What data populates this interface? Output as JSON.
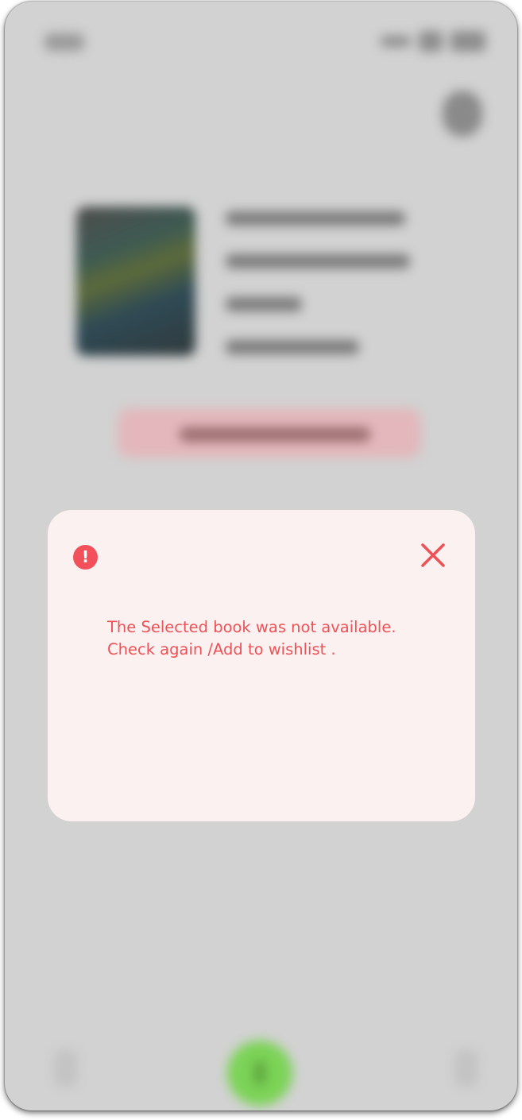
{
  "alert": {
    "icon": "exclamation-circle-icon",
    "icon_glyph": "!",
    "close_icon": "close-icon",
    "message_lines": [
      "The Selected book was not available.",
      "Check again /Add to wishlist ."
    ]
  },
  "colors": {
    "accent": "#ee5257",
    "dialog_background": "#fbf1f0",
    "overlay": "#d2d2d2",
    "nav_accent": "#7bd356"
  }
}
